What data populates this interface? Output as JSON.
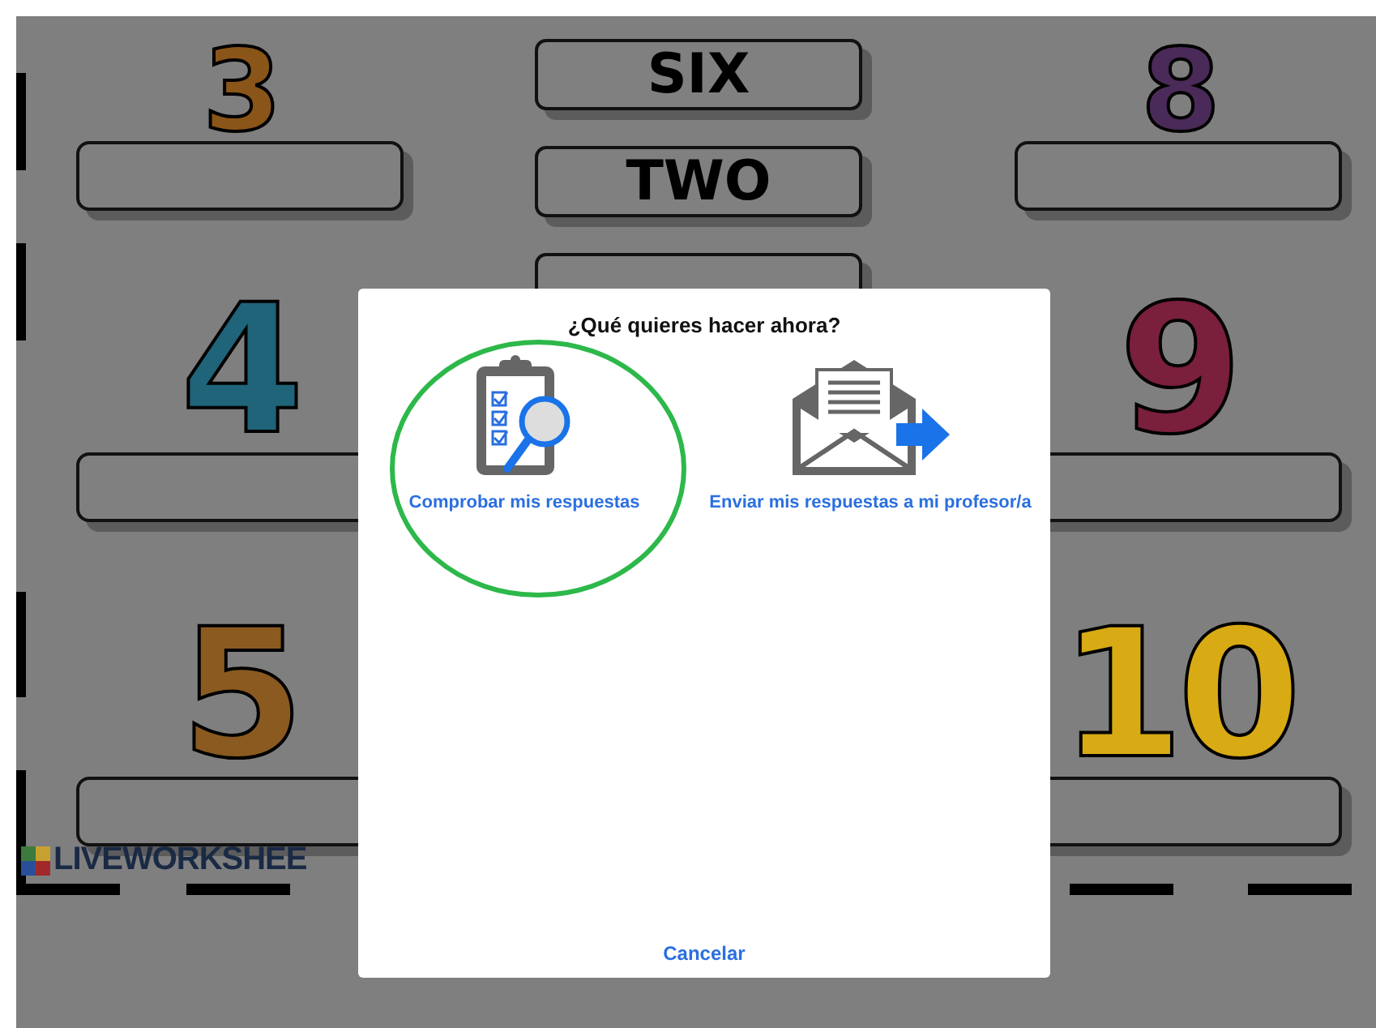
{
  "worksheet": {
    "logo": "LIVEWORKSHEE",
    "left_column": [
      {
        "numeral": "3",
        "color": "#8a5518"
      },
      {
        "numeral": "4",
        "color": "#1f6478"
      },
      {
        "numeral": "5",
        "color": "#8a5a20"
      }
    ],
    "word_tiles": [
      {
        "word": "SIX"
      },
      {
        "word": "TWO"
      }
    ],
    "right_column": [
      {
        "numeral": "8",
        "color": "#4a2a58"
      },
      {
        "numeral": "9",
        "color": "#7a1f3c"
      },
      {
        "numeral": "10",
        "color": "#d8aa14"
      }
    ]
  },
  "dialog": {
    "title": "¿Qué quieres hacer ahora?",
    "options": [
      {
        "kind": "check",
        "label": "Comprobar mis respuestas",
        "circled": true
      },
      {
        "kind": "send",
        "label": "Enviar mis respuestas a mi profesor/a",
        "circled": false
      }
    ],
    "cancel": "Cancelar"
  }
}
